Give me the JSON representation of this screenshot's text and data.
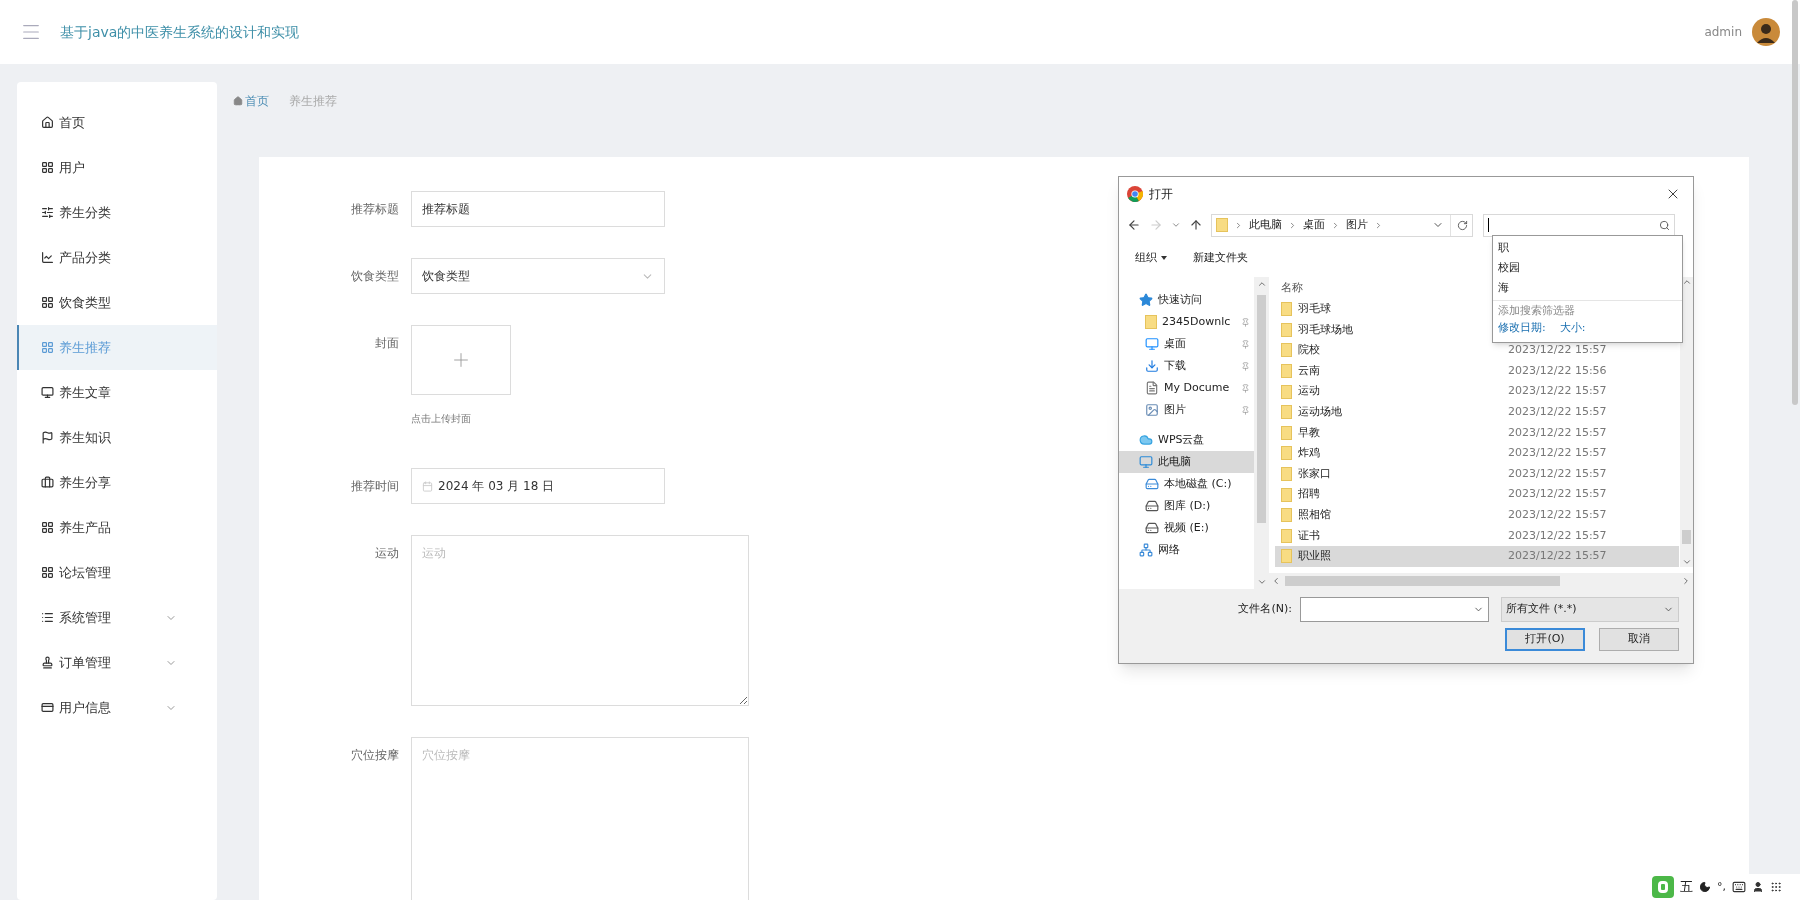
{
  "header": {
    "title": "基于java的中医养生系统的设计和实现",
    "user": "admin"
  },
  "sidebar": {
    "items": [
      {
        "label": "首页",
        "kind": "link",
        "selected": false
      },
      {
        "label": "用户",
        "kind": "link",
        "selected": false
      },
      {
        "label": "养生分类",
        "kind": "link",
        "selected": false
      },
      {
        "label": "产品分类",
        "kind": "link",
        "selected": false
      },
      {
        "label": "饮食类型",
        "kind": "link",
        "selected": false
      },
      {
        "label": "养生推荐",
        "kind": "link",
        "selected": true
      },
      {
        "label": "养生文章",
        "kind": "link",
        "selected": false
      },
      {
        "label": "养生知识",
        "kind": "link",
        "selected": false
      },
      {
        "label": "养生分享",
        "kind": "link",
        "selected": false
      },
      {
        "label": "养生产品",
        "kind": "link",
        "selected": false
      },
      {
        "label": "论坛管理",
        "kind": "link",
        "selected": false
      },
      {
        "label": "系统管理",
        "kind": "group",
        "selected": false,
        "expanded": false
      },
      {
        "label": "订单管理",
        "kind": "group",
        "selected": false,
        "expanded": false
      },
      {
        "label": "用户信息",
        "kind": "group",
        "selected": false,
        "expanded": false
      }
    ]
  },
  "breadcrumb": [
    "首页",
    "养生推荐"
  ],
  "form": {
    "fields": [
      {
        "kind": "text",
        "label": "推荐标题",
        "value": "推荐标题"
      },
      {
        "kind": "select",
        "label": "饮食类型",
        "value": "饮食类型"
      },
      {
        "kind": "upload",
        "label": "封面",
        "hint": "点击上传封面"
      },
      {
        "kind": "date",
        "label": "推荐时间",
        "value": "2024 年 03 月 18 日"
      },
      {
        "kind": "textarea",
        "label": "运动",
        "placeholder": "运动"
      },
      {
        "kind": "textarea",
        "label": "穴位按摩",
        "placeholder": "穴位按摩"
      }
    ]
  },
  "dialog": {
    "title": "打开",
    "path": [
      "此电脑",
      "桌面",
      "图片"
    ],
    "toolbar": [
      "组织",
      "新建文件夹"
    ],
    "search": {
      "suggestions": [
        "职",
        "校园",
        "海"
      ],
      "filter_title": "添加搜索筛选器",
      "filters": [
        "修改日期:",
        "大小:"
      ]
    },
    "nav": [
      {
        "label": "快速访问",
        "kind": "star",
        "selected": false,
        "children": [
          {
            "label": "2345Downlc",
            "kind": "folder",
            "selected": false,
            "pinned": true
          },
          {
            "label": "桌面",
            "kind": "desktop",
            "selected": false,
            "pinned": true
          },
          {
            "label": "下载",
            "kind": "download",
            "selected": false,
            "pinned": true
          },
          {
            "label": "My Docume",
            "kind": "document",
            "selected": false,
            "pinned": true
          },
          {
            "label": "图片",
            "kind": "pictures",
            "selected": false,
            "pinned": true
          }
        ]
      },
      {
        "label": "WPS云盘",
        "kind": "cloud",
        "selected": false
      },
      {
        "label": "此电脑",
        "kind": "pc",
        "selected": true,
        "children": [
          {
            "label": "本地磁盘 (C:)",
            "kind": "system-drive",
            "selected": false
          },
          {
            "label": "图库 (D:)",
            "kind": "drive",
            "selected": false
          },
          {
            "label": "视频 (E:)",
            "kind": "drive",
            "selected": false
          }
        ]
      },
      {
        "label": "网络",
        "kind": "network",
        "selected": false
      }
    ],
    "column": "名称",
    "files": [
      {
        "name": "羽毛球",
        "selected": false
      },
      {
        "name": "羽毛球场地",
        "selected": false
      },
      {
        "name": "院校",
        "date": "2023/12/22 15:57",
        "selected": false
      },
      {
        "name": "云南",
        "date": "2023/12/22 15:56",
        "selected": false
      },
      {
        "name": "运动",
        "date": "2023/12/22 15:57",
        "selected": false
      },
      {
        "name": "运动场地",
        "date": "2023/12/22 15:57",
        "selected": false
      },
      {
        "name": "早教",
        "date": "2023/12/22 15:57",
        "selected": false
      },
      {
        "name": "炸鸡",
        "date": "2023/12/22 15:57",
        "selected": false
      },
      {
        "name": "张家口",
        "date": "2023/12/22 15:57",
        "selected": false
      },
      {
        "name": "招聘",
        "date": "2023/12/22 15:57",
        "selected": false
      },
      {
        "name": "照相馆",
        "date": "2023/12/22 15:57",
        "selected": false
      },
      {
        "name": "证书",
        "date": "2023/12/22 15:57",
        "selected": false
      },
      {
        "name": "职业照",
        "date": "2023/12/22 15:57",
        "selected": true
      }
    ],
    "filename_label": "文件名(N):",
    "filetype": "所有文件 (*.*)",
    "buttons": [
      "打开(O)",
      "取消"
    ]
  },
  "ime": {
    "mode": "五",
    "punctuation": "°,"
  }
}
